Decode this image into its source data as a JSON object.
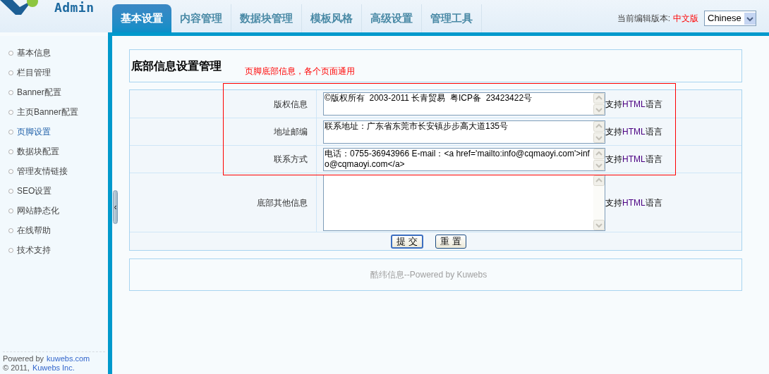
{
  "header": {
    "logo_text": "Admin",
    "tabs": [
      {
        "label": "基本设置",
        "selected": true
      },
      {
        "label": "内容管理",
        "selected": false
      },
      {
        "label": "数据块管理",
        "selected": false
      },
      {
        "label": "模板风格",
        "selected": false
      },
      {
        "label": "高级设置",
        "selected": false
      },
      {
        "label": "管理工具",
        "selected": false
      }
    ],
    "version_label": "当前编辑版本:",
    "version_value": "中文版",
    "language_select": "Chinese"
  },
  "sidebar": {
    "items": [
      {
        "label": "基本信息",
        "selected": false
      },
      {
        "label": "栏目管理",
        "selected": false
      },
      {
        "label": "Banner配置",
        "selected": false
      },
      {
        "label": "主页Banner配置",
        "selected": false
      },
      {
        "label": "页脚设置",
        "selected": true
      },
      {
        "label": "数据块配置",
        "selected": false
      },
      {
        "label": "管理友情链接",
        "selected": false
      },
      {
        "label": "SEO设置",
        "selected": false
      },
      {
        "label": "网站静态化",
        "selected": false
      },
      {
        "label": "在线帮助",
        "selected": false
      },
      {
        "label": "技术支持",
        "selected": false
      }
    ],
    "footer": {
      "powered_text": "Powered by",
      "powered_link": "kuwebs.com",
      "copyright_text": "© 2011,",
      "copyright_link": "Kuwebs Inc."
    }
  },
  "page": {
    "title": "底部信息设置管理",
    "note": "页脚底部信息，各个页面通用"
  },
  "form": {
    "rows": [
      {
        "label": "版权信息",
        "value": "©版权所有  2003-2011 长青贸易  粤ICP备  23423422号",
        "hint": {
          "before": "支持",
          "highlight": "HTML",
          "after": "语言"
        }
      },
      {
        "label": "地址邮编",
        "value": "联系地址：广东省东莞市长安镇步步高大道135号",
        "hint": {
          "before": "支持",
          "highlight": "HTML",
          "after": "语言"
        }
      },
      {
        "label": "联系方式",
        "value": "电话：0755-36943966 E-mail：<a href='mailto:info@cqmaoyi.com'>info@cqmaoyi.com</a>",
        "hint": {
          "before": "支持",
          "highlight": "HTML",
          "after": "语言"
        }
      },
      {
        "label": "底部其他信息",
        "value": "",
        "hint": {
          "before": "支持",
          "highlight": "HTML",
          "after": "语言"
        }
      }
    ],
    "buttons": [
      "提 交",
      "重 置"
    ]
  },
  "footer": {
    "text": "酷纬信息--Powered by Kuwebs"
  }
}
